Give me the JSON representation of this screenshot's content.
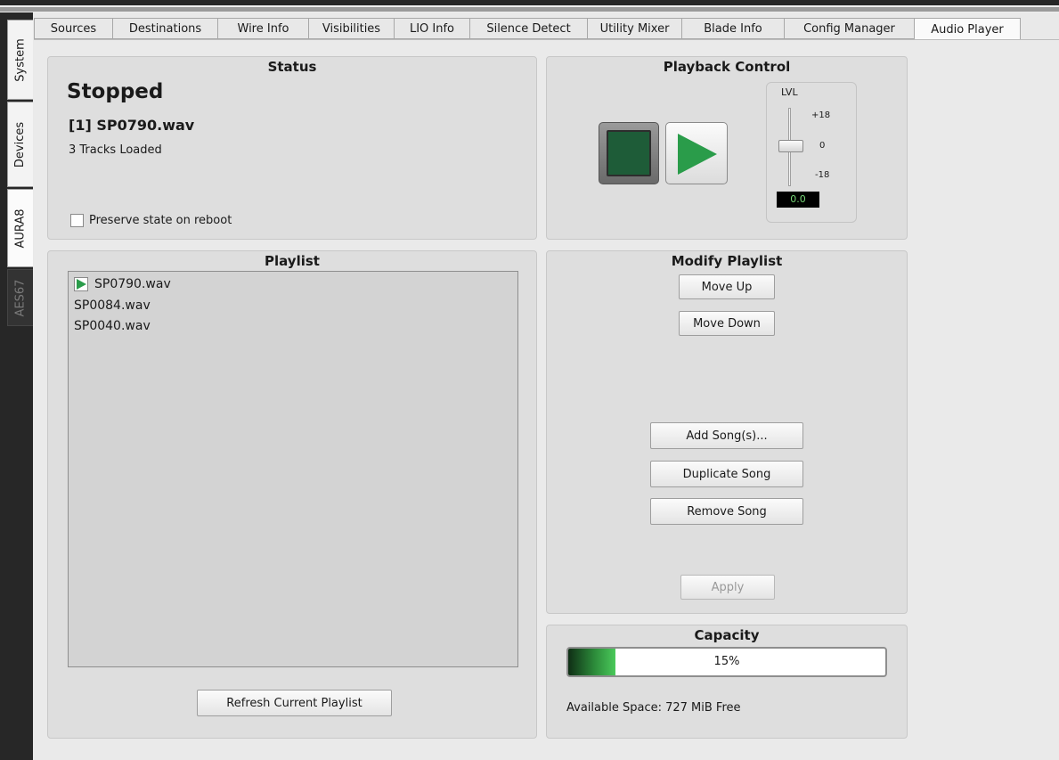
{
  "side_tabs": [
    {
      "label": "System"
    },
    {
      "label": "Devices"
    },
    {
      "label": "AURA8"
    },
    {
      "label": "AES67"
    }
  ],
  "tabs": [
    {
      "label": "Sources"
    },
    {
      "label": "Destinations"
    },
    {
      "label": "Wire Info"
    },
    {
      "label": "Visibilities"
    },
    {
      "label": "LIO Info"
    },
    {
      "label": "Silence Detect"
    },
    {
      "label": "Utility Mixer"
    },
    {
      "label": "Blade Info"
    },
    {
      "label": "Config Manager"
    },
    {
      "label": "Audio Player"
    }
  ],
  "status": {
    "title": "Status",
    "state": "Stopped",
    "current_track": "[1] SP0790.wav",
    "tracks_loaded": "3 Tracks Loaded",
    "preserve_label": "Preserve state on reboot",
    "preserve_checked": false
  },
  "playback": {
    "title": "Playback Control",
    "level_label": "LVL",
    "scale_top": "+18",
    "scale_mid": "0",
    "scale_bottom": "-18",
    "level_value": "0.0",
    "stop_icon": "stop-icon",
    "play_icon": "play-icon",
    "colors": {
      "stop": "#1e5c38",
      "play": "#2a9c4a"
    }
  },
  "playlist": {
    "title": "Playlist",
    "items": [
      {
        "name": "SP0790.wav",
        "playing": true
      },
      {
        "name": "SP0084.wav",
        "playing": false
      },
      {
        "name": "SP0040.wav",
        "playing": false
      }
    ],
    "refresh_label": "Refresh Current Playlist"
  },
  "modify": {
    "title": "Modify Playlist",
    "move_up": "Move Up",
    "move_down": "Move Down",
    "add": "Add Song(s)...",
    "duplicate": "Duplicate Song",
    "remove": "Remove Song",
    "apply": "Apply"
  },
  "capacity": {
    "title": "Capacity",
    "percent_text": "15%",
    "used_fraction": 0.15,
    "available": "Available Space: 727 MiB Free"
  }
}
